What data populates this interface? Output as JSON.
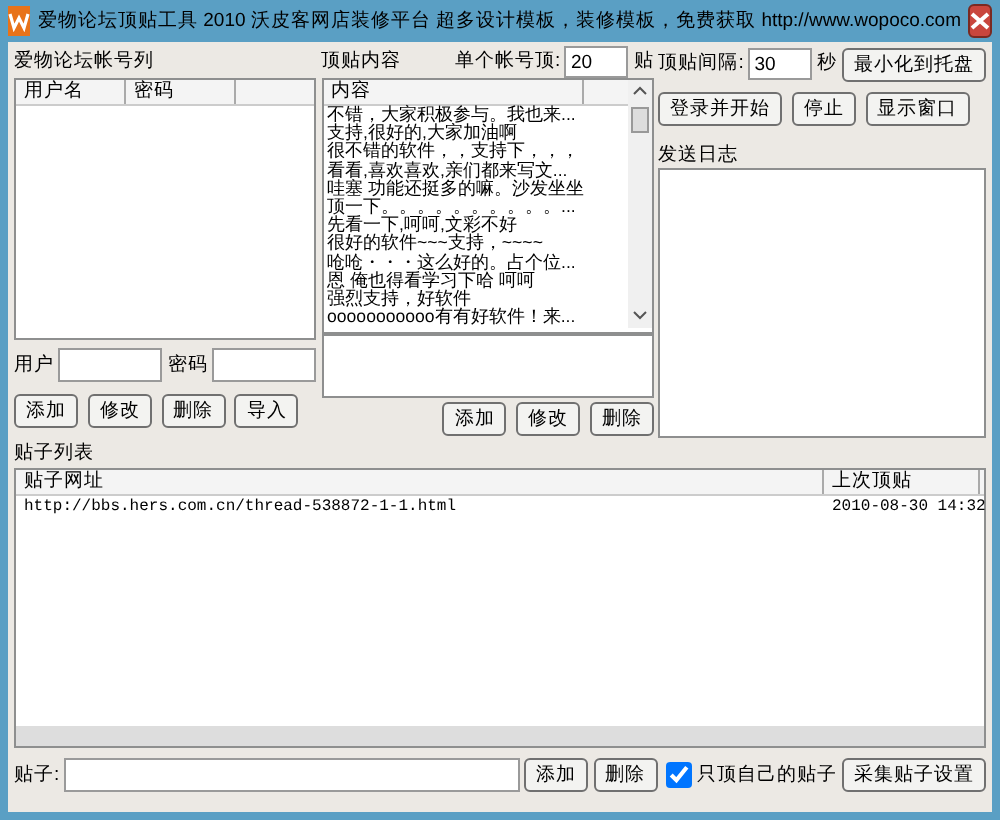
{
  "window": {
    "title": "爱物论坛顶贴工具 2010  沃皮客网店装修平台   超多设计模板，装修模板，免费获取 http://www.wopoco.com"
  },
  "accounts": {
    "label": "爱物论坛帐号列",
    "columns": [
      "用户名",
      "密码"
    ],
    "user_label": "用户",
    "password_label": "密码",
    "buttons": [
      "添加",
      "修改",
      "删除",
      "导入"
    ]
  },
  "content": {
    "label": "顶贴内容",
    "per_account_label": "单个帐号顶:",
    "per_account_value": "20",
    "per_account_unit": "贴",
    "column": "内容",
    "rows": [
      "不错，大家积极参与。我也来...",
      "支持,很好的,大家加油啊",
      "很不错的软件，，支持下，，，",
      "看看,喜欢喜欢,亲们都来写文...",
      "哇塞 功能还挺多的嘛。沙发坐坐",
      "顶一下。。。。。。。。。。...",
      "先看一下,呵呵,文彩不好",
      "很好的软件~~~支持，~~~~",
      "呛呛・・・这么好的。占个位...",
      "恩 俺也得看学习下哈 呵呵",
      "强烈支持，好软件",
      "ooooooooooo有有好软件！来..."
    ],
    "buttons": [
      "添加",
      "修改",
      "删除"
    ]
  },
  "interval": {
    "label": "顶贴间隔:",
    "value": "30",
    "unit": "秒"
  },
  "minimize_button": "最小化到托盘",
  "actions": [
    "登录并开始",
    "停止",
    "显示窗口"
  ],
  "log": {
    "label": "发送日志"
  },
  "posts": {
    "label": "贴子列表",
    "columns": [
      "贴子网址",
      "上次顶贴"
    ],
    "rows": [
      {
        "cells": [
          "http://bbs.hers.com.cn/thread-538872-1-1.html",
          "2010-08-30 14:32"
        ]
      }
    ]
  },
  "footer": {
    "label": "贴子:",
    "buttons": [
      "添加",
      "删除"
    ],
    "checkbox": {
      "label": "只顶自己的贴子",
      "checked": true
    },
    "settings_button": "采集贴子设置"
  }
}
